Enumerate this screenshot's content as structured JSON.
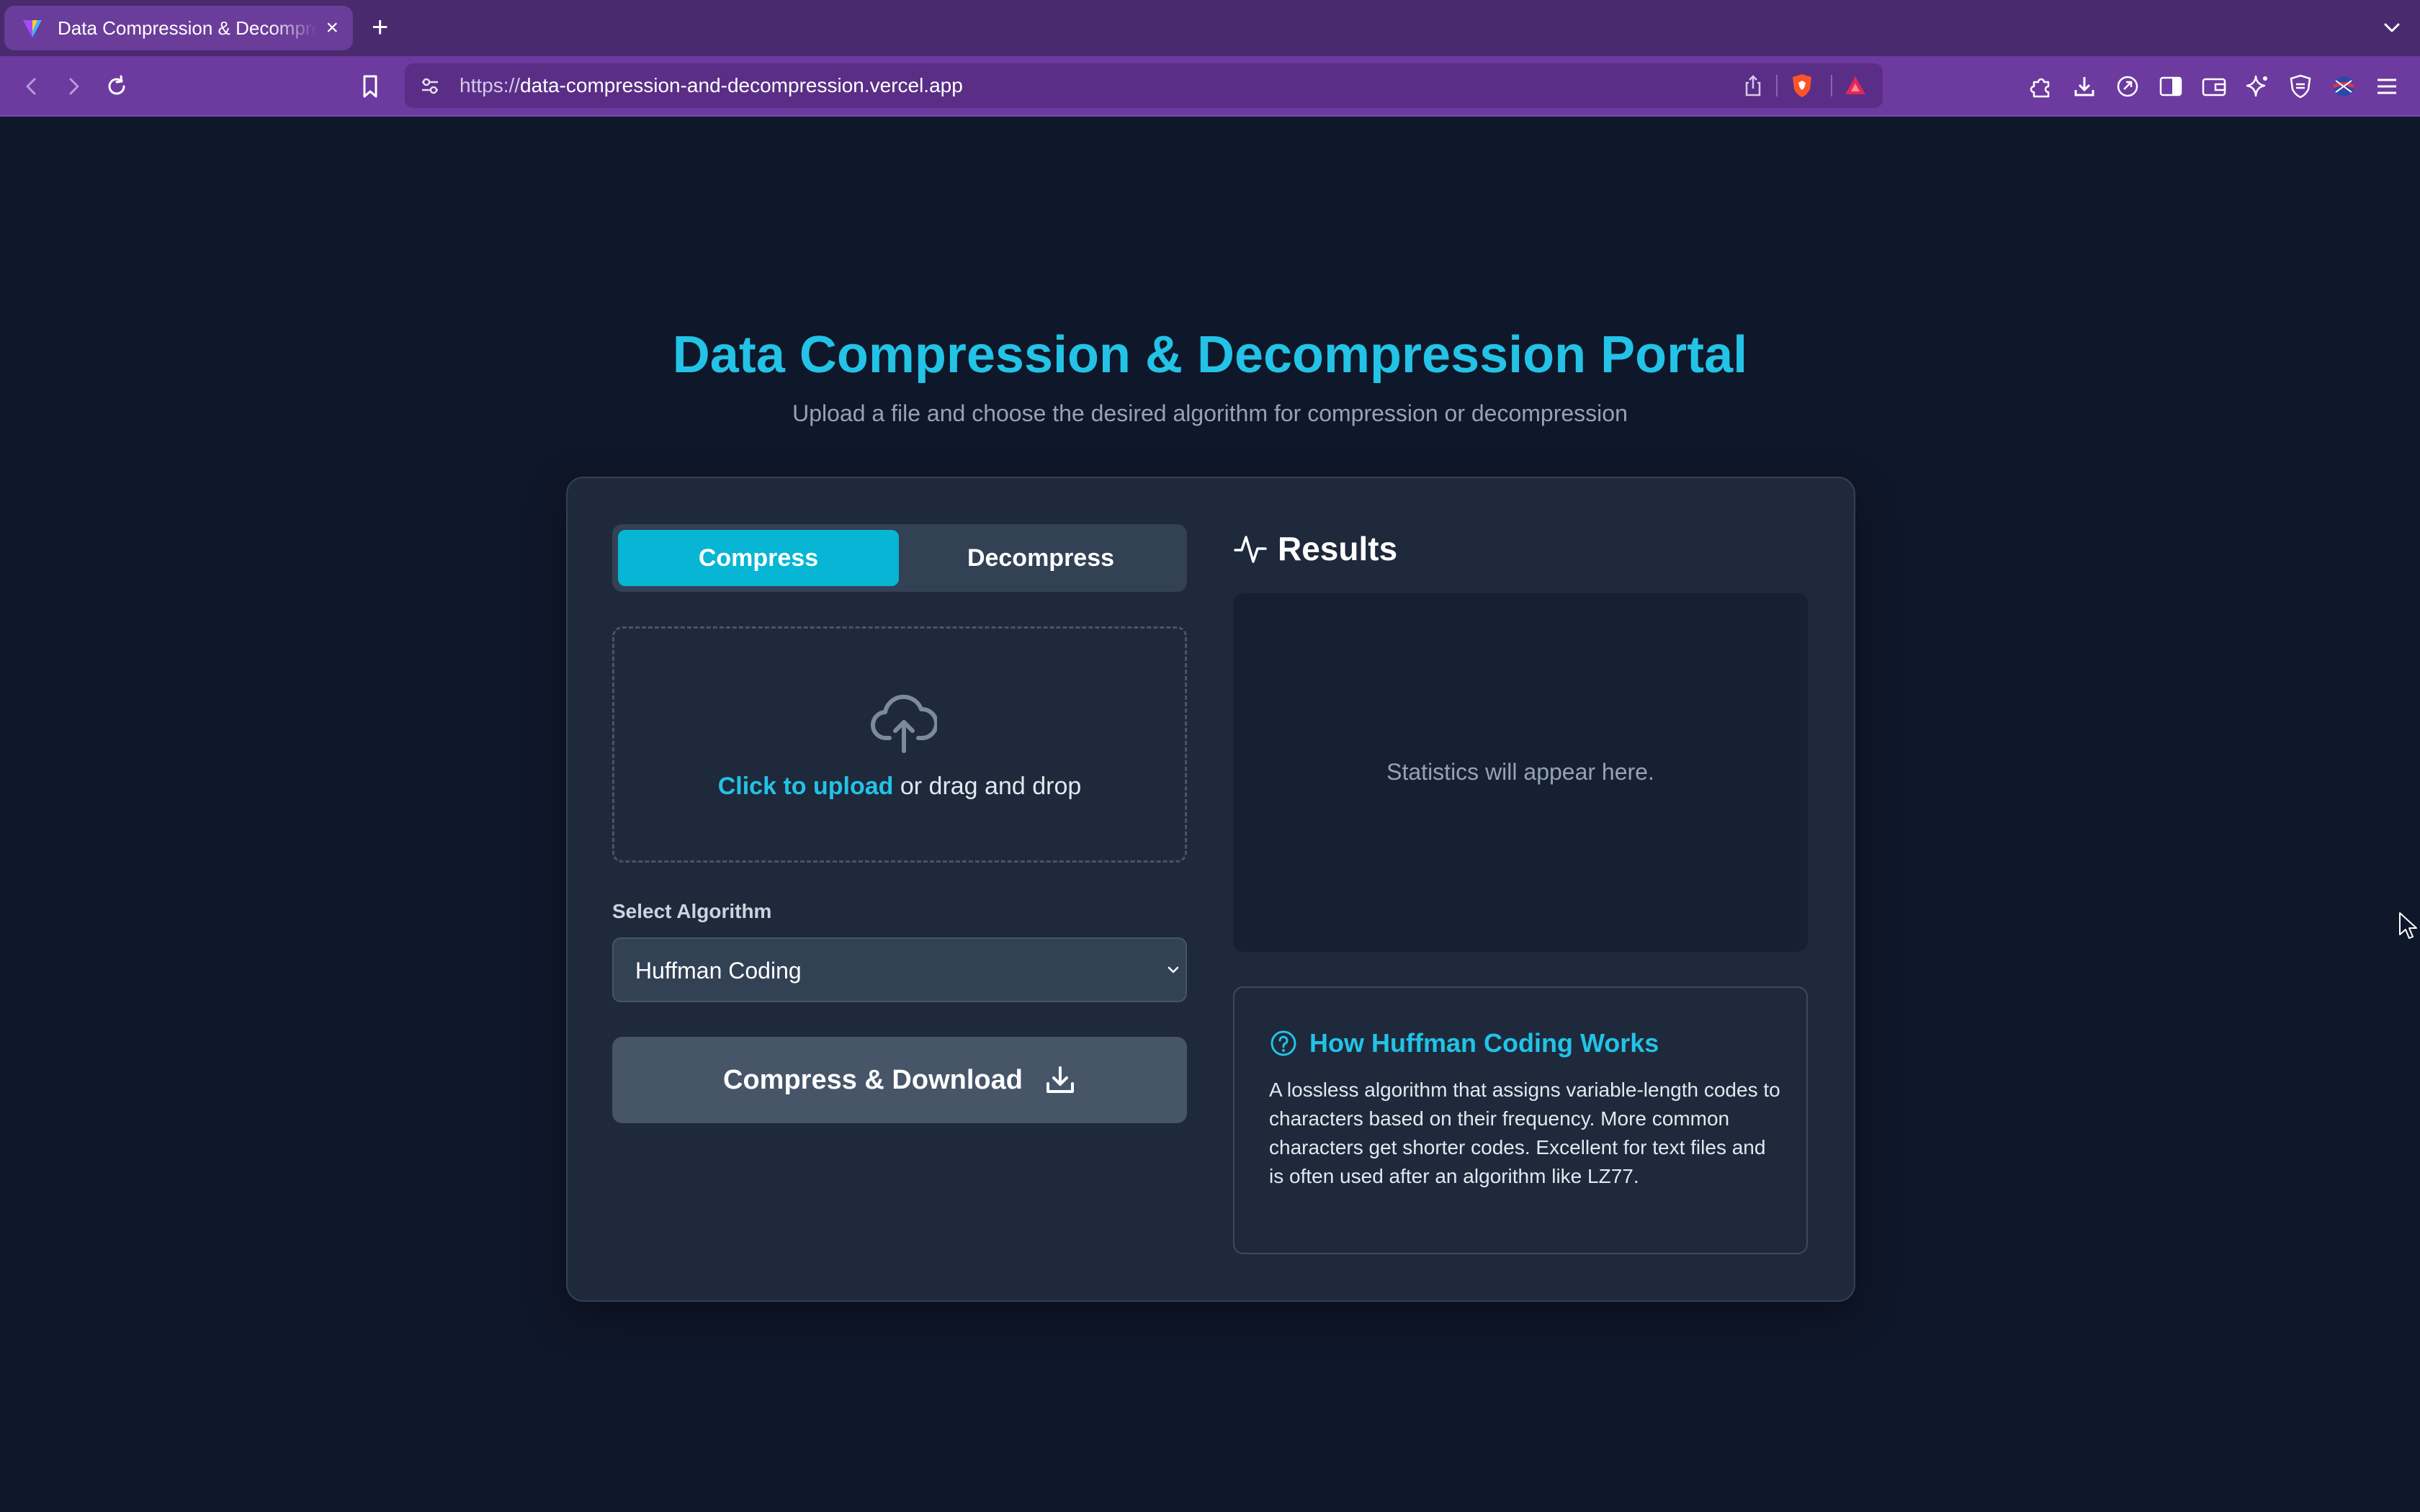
{
  "browser": {
    "tab_title": "Data Compression & Decompression",
    "tab_close": "×",
    "new_tab": "+",
    "url_scheme": "https://",
    "url_host": "data-compression-and-decompression.vercel.app"
  },
  "header": {
    "title": "Data Compression & Decompression Portal",
    "subtitle": "Upload a file and choose the desired algorithm for compression or decompression"
  },
  "mode_toggle": {
    "compress_label": "Compress",
    "decompress_label": "Decompress",
    "selected": "Compress"
  },
  "upload": {
    "link_text": "Click to upload",
    "rest_text": " or drag and drop"
  },
  "algorithm": {
    "label": "Select Algorithm",
    "selected": "Huffman Coding"
  },
  "action": {
    "label": "Compress & Download"
  },
  "results": {
    "title": "Results",
    "empty_text": "Statistics will appear here."
  },
  "info": {
    "title": "How Huffman Coding Works",
    "body": "A lossless algorithm that assigns variable-length codes to characters based on their frequency. More common characters get shorter codes. Excellent for text files and is often used after an algorithm like LZ77."
  },
  "colors": {
    "accent": "#06b6d4",
    "title": "#22c3e6",
    "background": "#0f172a",
    "card": "#1e293b",
    "browser_chrome": "#6d3aa0"
  }
}
